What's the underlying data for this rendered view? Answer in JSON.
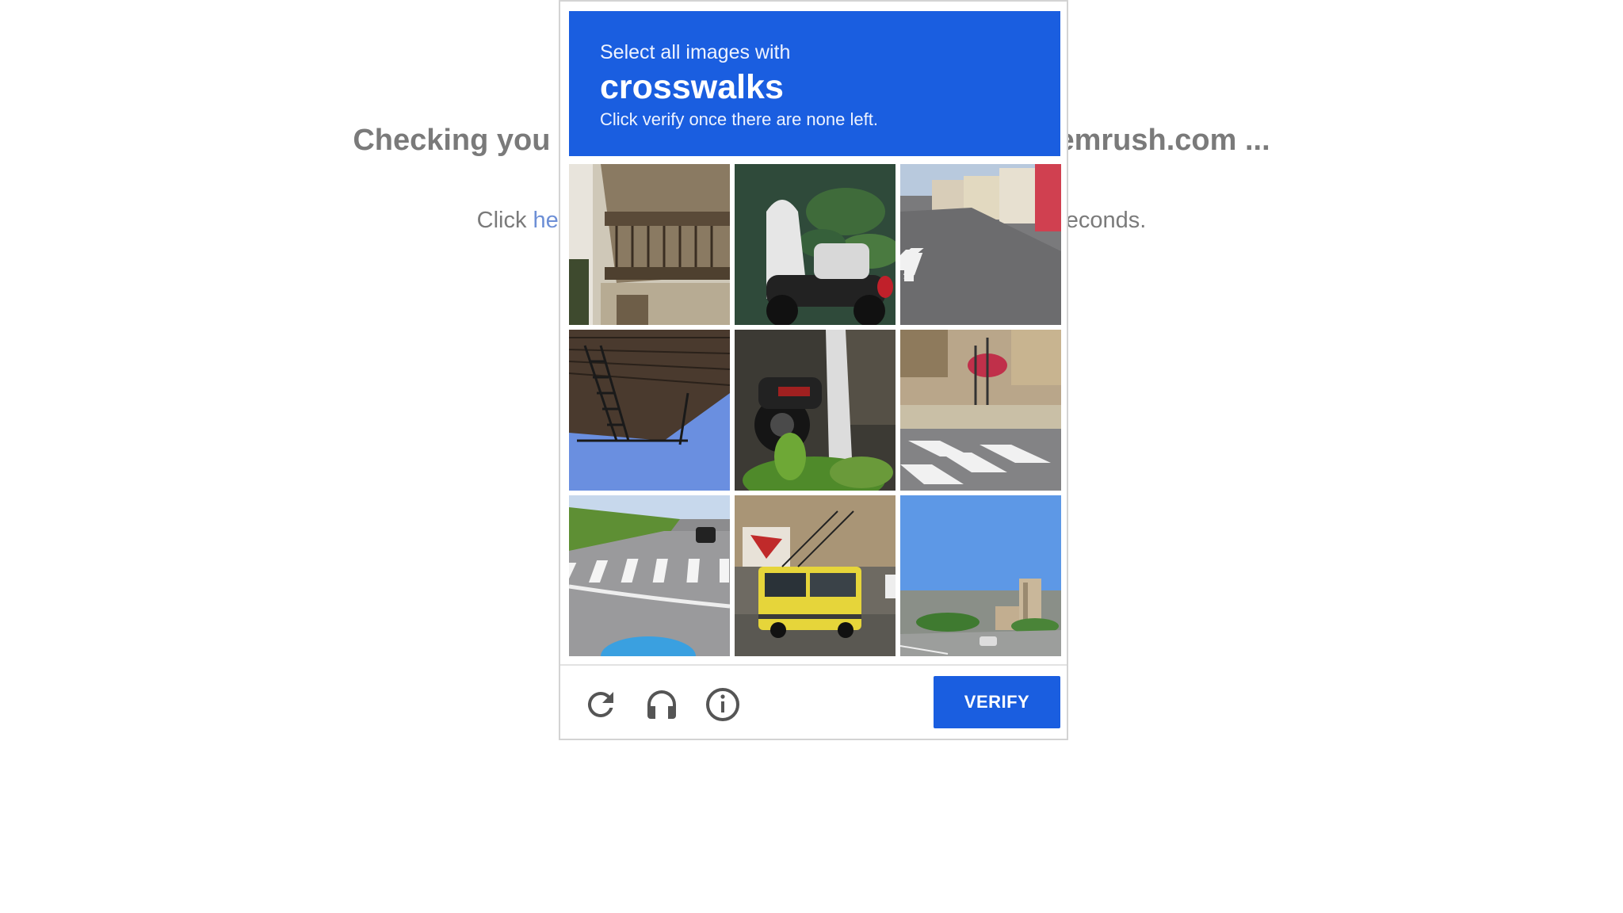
{
  "background": {
    "heading_left": "Checking you",
    "heading_right": "emrush.com ...",
    "sub_left": "Click ",
    "sub_link": "he",
    "sub_right": "econds."
  },
  "captcha": {
    "header": {
      "line1": "Select all images with",
      "target": "crosswalks",
      "line3": "Click verify once there are none left."
    },
    "tiles": [
      {
        "subject": "apartment balcony"
      },
      {
        "subject": "scooter near plant"
      },
      {
        "subject": "street with crosswalk"
      },
      {
        "subject": "fire escape stairs"
      },
      {
        "subject": "motorcycle behind pole"
      },
      {
        "subject": "crosswalk by buildings"
      },
      {
        "subject": "road with crosswalk"
      },
      {
        "subject": "yellow trolleybus"
      },
      {
        "subject": "highway with tall buildings"
      }
    ],
    "icons": {
      "reload": "reload-icon",
      "audio": "headphones-icon",
      "info": "info-icon"
    },
    "verify_label": "VERIFY",
    "accent_color": "#1a5ee0"
  }
}
